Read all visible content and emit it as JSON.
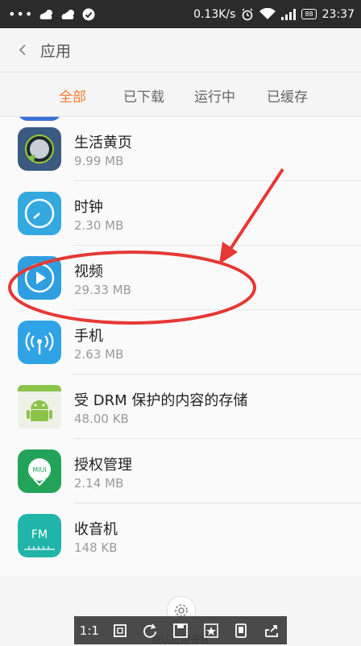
{
  "status_bar": {
    "speed": "0.13K/s",
    "battery": "88",
    "time": "23:37"
  },
  "header": {
    "title": "应用"
  },
  "tabs": [
    {
      "label": "全部",
      "active": true
    },
    {
      "label": "已下载",
      "active": false
    },
    {
      "label": "运行中",
      "active": false
    },
    {
      "label": "已缓存",
      "active": false
    }
  ],
  "apps": [
    {
      "name": "生活黄页",
      "size": "9.99 MB",
      "icon": "yellow-pages-icon"
    },
    {
      "name": "时钟",
      "size": "2.30 MB",
      "icon": "clock-icon"
    },
    {
      "name": "视频",
      "size": "29.33 MB",
      "icon": "video-play-icon"
    },
    {
      "name": "手机",
      "size": "2.63 MB",
      "icon": "phone-signal-icon"
    },
    {
      "name": "受 DRM 保护的内容的存储",
      "size": "48.00 KB",
      "icon": "android-icon"
    },
    {
      "name": "授权管理",
      "size": "2.14 MB",
      "icon": "miui-shield-icon"
    },
    {
      "name": "收音机",
      "size": "148 KB",
      "icon": "fm-radio-icon"
    }
  ],
  "bottom": {
    "settings_label": "默认应用设置"
  },
  "toolbar": {
    "ratio_label": "1:1"
  },
  "colors": {
    "accent": "#f57c2c",
    "annotation": "#e53935"
  }
}
